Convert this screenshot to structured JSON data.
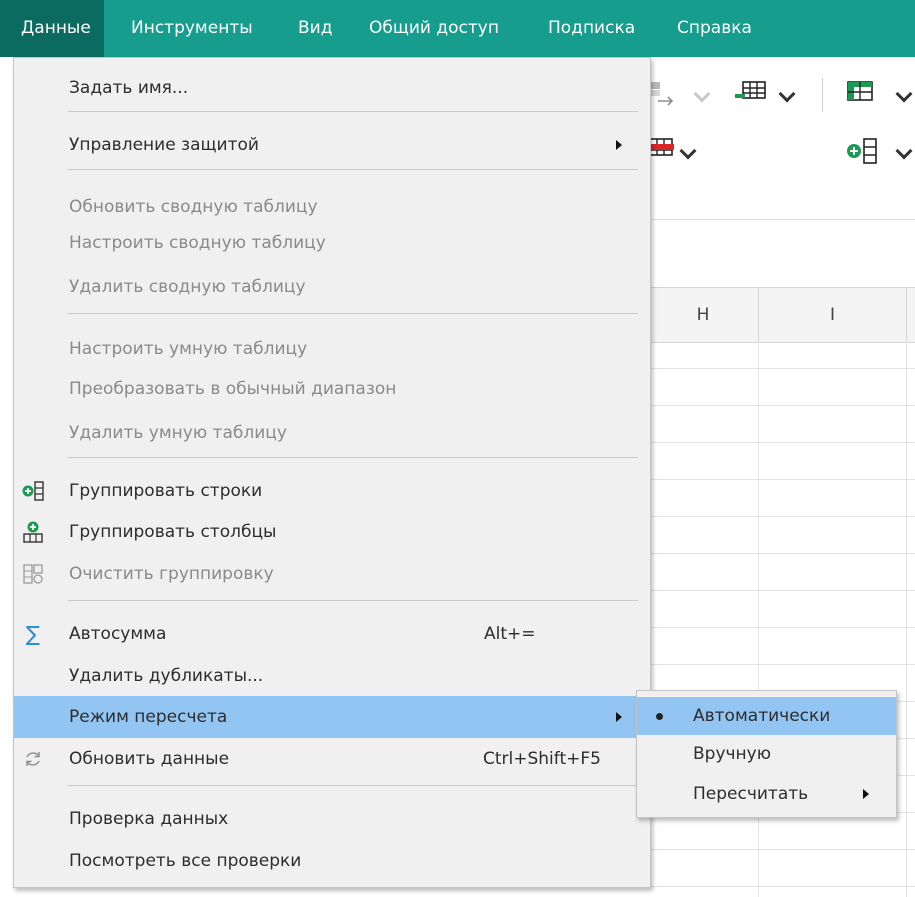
{
  "menubar": {
    "items": [
      "Данные",
      "Инструменты",
      "Вид",
      "Общий доступ",
      "Подписка",
      "Справка"
    ],
    "active_index": 0
  },
  "sheet": {
    "columns": [
      "H",
      "I"
    ]
  },
  "menu": {
    "define_name": "Задать имя...",
    "protection": "Управление защитой",
    "refresh_pivot": "Обновить сводную таблицу",
    "configure_pivot": "Настроить сводную таблицу",
    "delete_pivot": "Удалить сводную таблицу",
    "configure_smart": "Настроить умную таблицу",
    "convert_range": "Преобразовать в обычный диапазон",
    "delete_smart": "Удалить умную таблицу",
    "group_rows": "Группировать строки",
    "group_columns": "Группировать столбцы",
    "clear_grouping": "Очистить группировку",
    "autosum": "Автосумма",
    "autosum_shortcut": "Alt+=",
    "remove_duplicates": "Удалить дубликаты...",
    "recalc_mode": "Режим пересчета",
    "refresh_data": "Обновить данные",
    "refresh_data_shortcut": "Ctrl+Shift+F5",
    "data_validation": "Проверка данных",
    "view_validations": "Посмотреть все проверки"
  },
  "submenu": {
    "automatic": "Автоматически",
    "manual": "Вручную",
    "recalculate": "Пересчитать"
  },
  "colors": {
    "menubar": "#169d8e",
    "menubar_active": "#0c6b60",
    "highlight": "#92c5f2",
    "icon_green": "#1a9a52",
    "icon_blue": "#2b8fd6"
  }
}
